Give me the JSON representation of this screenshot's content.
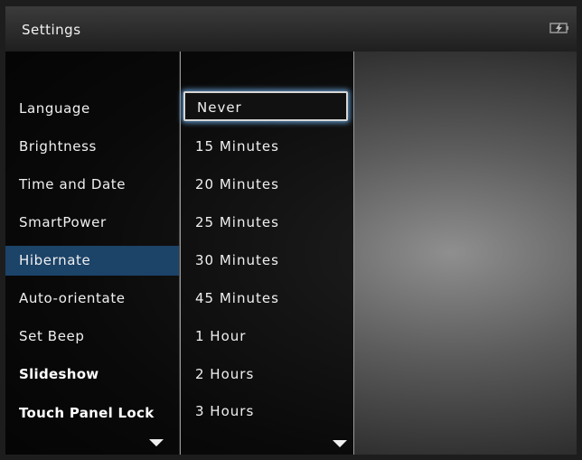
{
  "header": {
    "title": "Settings",
    "status_icon": "battery-charging-icon"
  },
  "menu": {
    "items": [
      {
        "label": "Language"
      },
      {
        "label": "Brightness"
      },
      {
        "label": "Time and Date"
      },
      {
        "label": "SmartPower"
      },
      {
        "label": "Hibernate"
      },
      {
        "label": "Auto-orientate"
      },
      {
        "label": "Set Beep"
      },
      {
        "label": "Slideshow"
      },
      {
        "label": "Touch Panel Lock"
      }
    ],
    "selected": "Hibernate",
    "more_icon": "chevron-down-icon"
  },
  "options": {
    "items": [
      {
        "label": "Never"
      },
      {
        "label": "15 Minutes"
      },
      {
        "label": "20 Minutes"
      },
      {
        "label": "25 Minutes"
      },
      {
        "label": "30 Minutes"
      },
      {
        "label": "45 Minutes"
      },
      {
        "label": "1 Hour"
      },
      {
        "label": "2 Hours"
      },
      {
        "label": "3 Hours"
      }
    ],
    "focused": "Never",
    "more_icon": "chevron-down-icon"
  },
  "colors": {
    "selection": "#1c4368",
    "focus_glow": "#5b8fbf"
  }
}
